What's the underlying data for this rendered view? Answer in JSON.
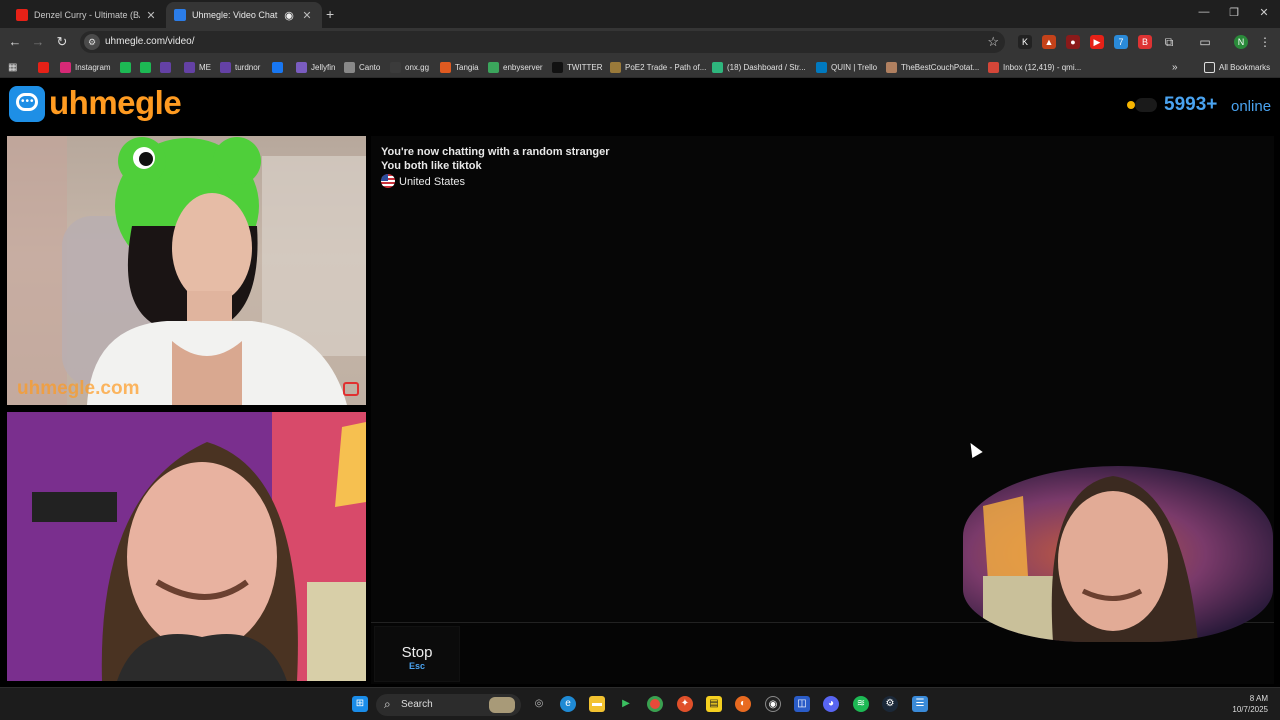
{
  "tabs": [
    {
      "title": "Denzel Curry - Ultimate (BADB",
      "active": false,
      "favicon_color": "#e62117"
    },
    {
      "title": "Uhmegle: Video Chat | Om",
      "active": true,
      "favicon_color": "#2b7de9"
    }
  ],
  "address_bar": {
    "url": "uhmegle.com/video/"
  },
  "bookmarks": [
    {
      "label": "",
      "color": "#e62117"
    },
    {
      "label": "Instagram",
      "color": "#d62976"
    },
    {
      "label": "",
      "color": "#1db954"
    },
    {
      "label": "",
      "color": "#1db954"
    },
    {
      "label": "",
      "color": "#6441a5"
    },
    {
      "label": "ME",
      "color": "#6441a5"
    },
    {
      "label": "turdnor",
      "color": "#6441a5"
    },
    {
      "label": "",
      "color": "#1877f2"
    },
    {
      "label": "Jellyfin",
      "color": "#7a5cc0"
    },
    {
      "label": "Canto",
      "color": "#888888"
    },
    {
      "label": "onx.gg",
      "color": "#3b3b3b"
    },
    {
      "label": "Tangia",
      "color": "#e05a20"
    },
    {
      "label": "enbyserver",
      "color": "#3ba55c"
    },
    {
      "label": "TWITTER",
      "color": "#111111"
    },
    {
      "label": "PoE2 Trade - Path of...",
      "color": "#9a7a3a"
    },
    {
      "label": "(18) Dashboard / Str...",
      "color": "#2eb67d"
    },
    {
      "label": "QUIN | Trello",
      "color": "#0079bf"
    },
    {
      "label": "TheBestCouchPotat...",
      "color": "#b08060"
    },
    {
      "label": "Inbox (12,419) - qmi...",
      "color": "#d44638"
    }
  ],
  "all_bookmarks_label": "All Bookmarks",
  "site": {
    "logo_text": "uhmegle",
    "online_count": "5993+",
    "online_label": "online"
  },
  "chat": {
    "lines": [
      "You're now chatting with a random stranger",
      "You both like tiktok"
    ],
    "country": "United States"
  },
  "controls": {
    "stop_label": "Stop",
    "stop_key": "Esc"
  },
  "video": {
    "watermark": "uhmegle.com"
  },
  "taskbar": {
    "search_label": "Search",
    "time": "8 AM",
    "date": "10/7/2025"
  }
}
